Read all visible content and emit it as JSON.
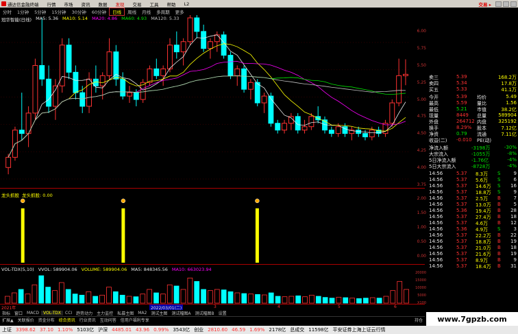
{
  "menubar": {
    "app_title": "通达信金融终端",
    "items": [
      "行情",
      "市场",
      "资讯",
      "数据",
      "发现",
      "交易",
      "工具",
      "帮助"
    ],
    "active_index": 4,
    "version": "L2",
    "brand": "交易 ▸"
  },
  "periods": [
    "分时",
    "1分钟",
    "5分钟",
    "15分钟",
    "30分钟",
    "60分钟",
    "日线",
    "周线",
    "月线",
    "多周期",
    "更多"
  ],
  "active_period_index": 6,
  "ma_legend": {
    "stock": "冠华智能(日线)",
    "ma5": "MA5: 5.36",
    "ma10": "MA10: 5.14",
    "ma20": "MA20: 4.86",
    "ma60": "MA60: 4.93",
    "ma120": "MA120: 5.33",
    "peak_label": "7.58"
  },
  "price_axis": [
    "6.00",
    "5.75",
    "5.50",
    "5.25",
    "5.00",
    "4.75",
    "4.50",
    "4.25",
    "4.00",
    "3.75"
  ],
  "ind1_axis": [
    "2.00",
    "1.50",
    "1.00",
    "0.50",
    "0.00"
  ],
  "vol_axis": [
    "20000",
    "15000",
    "10000",
    "5000",
    "X100"
  ],
  "indicator1": {
    "name": "龙头抓股",
    "label": "龙头抓股: 0.00"
  },
  "volume": {
    "title": "VOL-TDX(5,10)",
    "vvol": "VVOL: 589904.06",
    "volume": "VOLUME: 589904.06",
    "ma5": "MA5: 848345.56",
    "ma10": "MA10: 663023.94"
  },
  "dates": {
    "start": "2021年",
    "mid": "2022/03/01(二)",
    "m3": "3",
    "m4": "4",
    "m5": "5",
    "m6": "6"
  },
  "tabs": [
    "指标",
    "窗口",
    "MACD",
    "VOL-TDX",
    "CCI",
    "趋势动力",
    "主力监控",
    "私募主图",
    "MA2",
    "测试主图",
    "测试幅图A",
    "测试幅图B",
    "设置"
  ],
  "selected_tab_index": 3,
  "tabs2": [
    "扩展▲",
    "关联报价",
    "资金分布",
    "综合资讯",
    "行业资讯",
    "互动问答",
    "信用户福利专享"
  ],
  "tabs2_right": "持仓",
  "quote": {
    "asks": [
      {
        "name": "卖三",
        "price": "5.39",
        "vol": "168.2万"
      },
      {
        "name": "卖四",
        "price": "5.34",
        "vol": "17.8万"
      },
      {
        "name": "买五",
        "price": "5.33",
        "vol": "41.1万"
      }
    ],
    "stats": [
      {
        "l1": "今开",
        "v1": "5.39",
        "l2": "均价",
        "v2": "5.49"
      },
      {
        "l1": "最高",
        "v1": "5.59",
        "l2": "量比",
        "v2": "1.56"
      },
      {
        "l1": "最低",
        "v1": "5.21",
        "l2": "市值",
        "v2": "38.2亿"
      },
      {
        "l1": "现量",
        "v1": "8449",
        "l2": "总量",
        "v2": "589904"
      },
      {
        "l1": "外盘",
        "v1": "264712",
        "l2": "内盘",
        "v2": "325192"
      },
      {
        "l1": "换手",
        "v1": "8.29%",
        "l2": "股本",
        "v2": "7.12亿"
      },
      {
        "l1": "净资",
        "v1": "0.79",
        "l2": "流通",
        "v2": "7.11亿"
      },
      {
        "l1": "收益(二)",
        "v1": "-0.010",
        "l2": "PE(动)",
        "v2": ""
      }
    ],
    "flows": [
      {
        "label": "净流入额",
        "value": "-3198万",
        "pct": "-30%"
      },
      {
        "label": "大宗流入",
        "value": "-1055万",
        "pct": "-8%"
      },
      {
        "label": "5日净流入额",
        "value": "-1.76亿",
        "pct": "-4%"
      },
      {
        "label": "5日大宗流入",
        "value": "-8728万",
        "pct": "-4%"
      }
    ],
    "ticks": [
      {
        "t": "14:56",
        "p": "5.37",
        "v": "8.3万",
        "d": "S",
        "n": "9"
      },
      {
        "t": "14:56",
        "p": "5.37",
        "v": "5.6万",
        "d": "S",
        "n": "6"
      },
      {
        "t": "14:56",
        "p": "5.37",
        "v": "14.6万",
        "d": "S",
        "n": "16"
      },
      {
        "t": "14:56",
        "p": "5.37",
        "v": "18.8万",
        "d": "S",
        "n": "9"
      },
      {
        "t": "14:56",
        "p": "5.37",
        "v": "2.5万",
        "d": "B",
        "n": "7"
      },
      {
        "t": "14:56",
        "p": "5.37",
        "v": "13.0万",
        "d": "B",
        "n": "5"
      },
      {
        "t": "14:56",
        "p": "5.36",
        "v": "19.4万",
        "d": "B",
        "n": "28"
      },
      {
        "t": "14:56",
        "p": "5.37",
        "v": "27.4万",
        "d": "B",
        "n": "18"
      },
      {
        "t": "14:56",
        "p": "5.37",
        "v": "4.6万",
        "d": "B",
        "n": "12"
      },
      {
        "t": "14:56",
        "p": "5.36",
        "v": "4.9万",
        "d": "S",
        "n": "3"
      },
      {
        "t": "14:56",
        "p": "5.37",
        "v": "22.2万",
        "d": "B",
        "n": "22"
      },
      {
        "t": "14:56",
        "p": "5.37",
        "v": "18.8万",
        "d": "B",
        "n": "19"
      },
      {
        "t": "14:56",
        "p": "5.37",
        "v": "21.0万",
        "d": "B",
        "n": "18"
      },
      {
        "t": "14:56",
        "p": "5.37",
        "v": "21.6万",
        "d": "B",
        "n": "19"
      },
      {
        "t": "14:56",
        "p": "5.37",
        "v": "8.9万",
        "d": "B",
        "n": "9"
      },
      {
        "t": "14:56",
        "p": "5.37",
        "v": "18.4万",
        "d": "B",
        "n": "31"
      }
    ]
  },
  "statusbar": {
    "sh_label": "上证",
    "sh_value": "3398.62",
    "sh_change": "37.10",
    "sh_pct": "1.10%",
    "sh_amount": "5103亿",
    "hs_label": "沪深",
    "hs_value": "4485.01",
    "hs_change": "43.96",
    "hs_pct": "0.99%",
    "hs_amount": "3543亿",
    "cy_label": "创业",
    "cy_value": "2810.60",
    "cy_change": "46.59",
    "cy_pct": "1.69%",
    "cy_amount": "2178亿",
    "zc_label": "总成交",
    "zc_value": "11598亿",
    "right_text": "平安证券上海上证云行情"
  },
  "watermark": "www.7gpzb.com",
  "colors": {
    "up": "#ff3232",
    "down": "#00ffff",
    "ma5": "#e8e8e8",
    "ma10": "#ffff00",
    "ma20": "#ff00ff",
    "ma60": "#00e600",
    "ma120": "#c0c0c0",
    "signal": "#ffff00"
  },
  "chart_data": {
    "type": "candlestick",
    "ylim": [
      3.75,
      6.1
    ],
    "candles": [
      [
        4.0,
        4.2,
        3.9,
        4.15
      ],
      [
        4.15,
        4.6,
        4.1,
        4.55
      ],
      [
        4.55,
        5.1,
        4.4,
        4.5
      ],
      [
        4.5,
        4.9,
        4.3,
        4.8
      ],
      [
        4.8,
        5.6,
        4.7,
        5.5
      ],
      [
        5.5,
        6.2,
        5.2,
        5.3
      ],
      [
        5.3,
        5.5,
        4.8,
        4.9
      ],
      [
        4.9,
        5.3,
        4.7,
        5.2
      ],
      [
        5.2,
        5.9,
        5.1,
        5.8
      ],
      [
        5.8,
        5.9,
        5.3,
        5.4
      ],
      [
        5.4,
        5.5,
        5.0,
        5.1
      ],
      [
        5.1,
        5.2,
        4.8,
        4.9
      ],
      [
        4.9,
        5.4,
        4.8,
        5.3
      ],
      [
        5.3,
        5.5,
        5.1,
        5.2
      ],
      [
        5.2,
        5.4,
        5.0,
        5.35
      ],
      [
        5.35,
        5.9,
        5.3,
        5.7
      ],
      [
        5.7,
        5.8,
        5.2,
        5.3
      ],
      [
        5.3,
        5.4,
        5.0,
        5.05
      ],
      [
        5.05,
        5.2,
        4.95,
        5.1
      ],
      [
        5.1,
        5.15,
        4.9,
        5.0
      ],
      [
        5.0,
        5.3,
        4.95,
        5.25
      ],
      [
        5.25,
        5.5,
        5.2,
        5.45
      ],
      [
        5.45,
        5.6,
        5.3,
        5.35
      ],
      [
        5.35,
        5.5,
        5.2,
        5.45
      ],
      [
        5.45,
        5.9,
        5.4,
        5.8
      ],
      [
        5.8,
        6.0,
        5.6,
        5.7
      ],
      [
        5.7,
        5.9,
        5.5,
        5.85
      ],
      [
        5.85,
        6.3,
        5.8,
        6.2
      ],
      [
        6.2,
        6.4,
        5.9,
        6.0
      ],
      [
        6.0,
        6.1,
        5.7,
        5.75
      ],
      [
        5.75,
        5.9,
        5.6,
        5.85
      ],
      [
        5.85,
        6.0,
        5.7,
        5.95
      ],
      [
        5.95,
        6.0,
        5.6,
        5.65
      ],
      [
        5.65,
        5.7,
        5.3,
        5.35
      ],
      [
        5.35,
        5.5,
        5.2,
        5.45
      ],
      [
        5.45,
        5.5,
        5.1,
        5.15
      ],
      [
        5.15,
        5.3,
        5.0,
        5.25
      ],
      [
        5.25,
        5.3,
        4.9,
        4.95
      ],
      [
        4.95,
        5.1,
        4.8,
        5.05
      ],
      [
        5.05,
        5.1,
        4.6,
        4.65
      ],
      [
        4.65,
        4.7,
        4.5,
        4.55
      ],
      [
        4.55,
        4.7,
        4.5,
        4.65
      ],
      [
        4.65,
        4.8,
        4.55,
        4.75
      ],
      [
        4.75,
        4.8,
        4.5,
        4.55
      ],
      [
        4.55,
        4.7,
        4.5,
        4.6
      ],
      [
        4.6,
        4.8,
        4.55,
        4.75
      ],
      [
        4.75,
        4.9,
        4.65,
        4.7
      ],
      [
        4.7,
        4.75,
        4.5,
        4.55
      ],
      [
        4.55,
        4.6,
        4.45,
        4.5
      ],
      [
        4.5,
        4.65,
        4.45,
        4.6
      ],
      [
        4.6,
        4.65,
        4.45,
        4.5
      ],
      [
        4.5,
        4.6,
        4.4,
        4.55
      ],
      [
        4.55,
        4.6,
        4.45,
        4.5
      ],
      [
        4.5,
        4.55,
        4.4,
        4.45
      ],
      [
        4.45,
        4.6,
        4.4,
        4.55
      ],
      [
        4.55,
        4.6,
        4.45,
        4.5
      ],
      [
        4.5,
        4.7,
        4.45,
        4.65
      ],
      [
        4.65,
        5.0,
        4.6,
        4.95
      ],
      [
        4.95,
        5.6,
        4.9,
        5.35
      ],
      [
        5.35,
        5.59,
        5.21,
        5.37
      ]
    ],
    "signals": [
      2,
      17,
      37
    ],
    "volumes": [
      30,
      45,
      60,
      40,
      80,
      120,
      70,
      55,
      90,
      60,
      40,
      35,
      50,
      30,
      35,
      70,
      50,
      35,
      30,
      28,
      40,
      60,
      45,
      40,
      80,
      75,
      60,
      110,
      95,
      60,
      55,
      60,
      58,
      50,
      45,
      42,
      40,
      38,
      36,
      45,
      30,
      28,
      30,
      32,
      28,
      35,
      30,
      25,
      22,
      26,
      24,
      22,
      20,
      22,
      24,
      22,
      30,
      55,
      95,
      60
    ]
  }
}
